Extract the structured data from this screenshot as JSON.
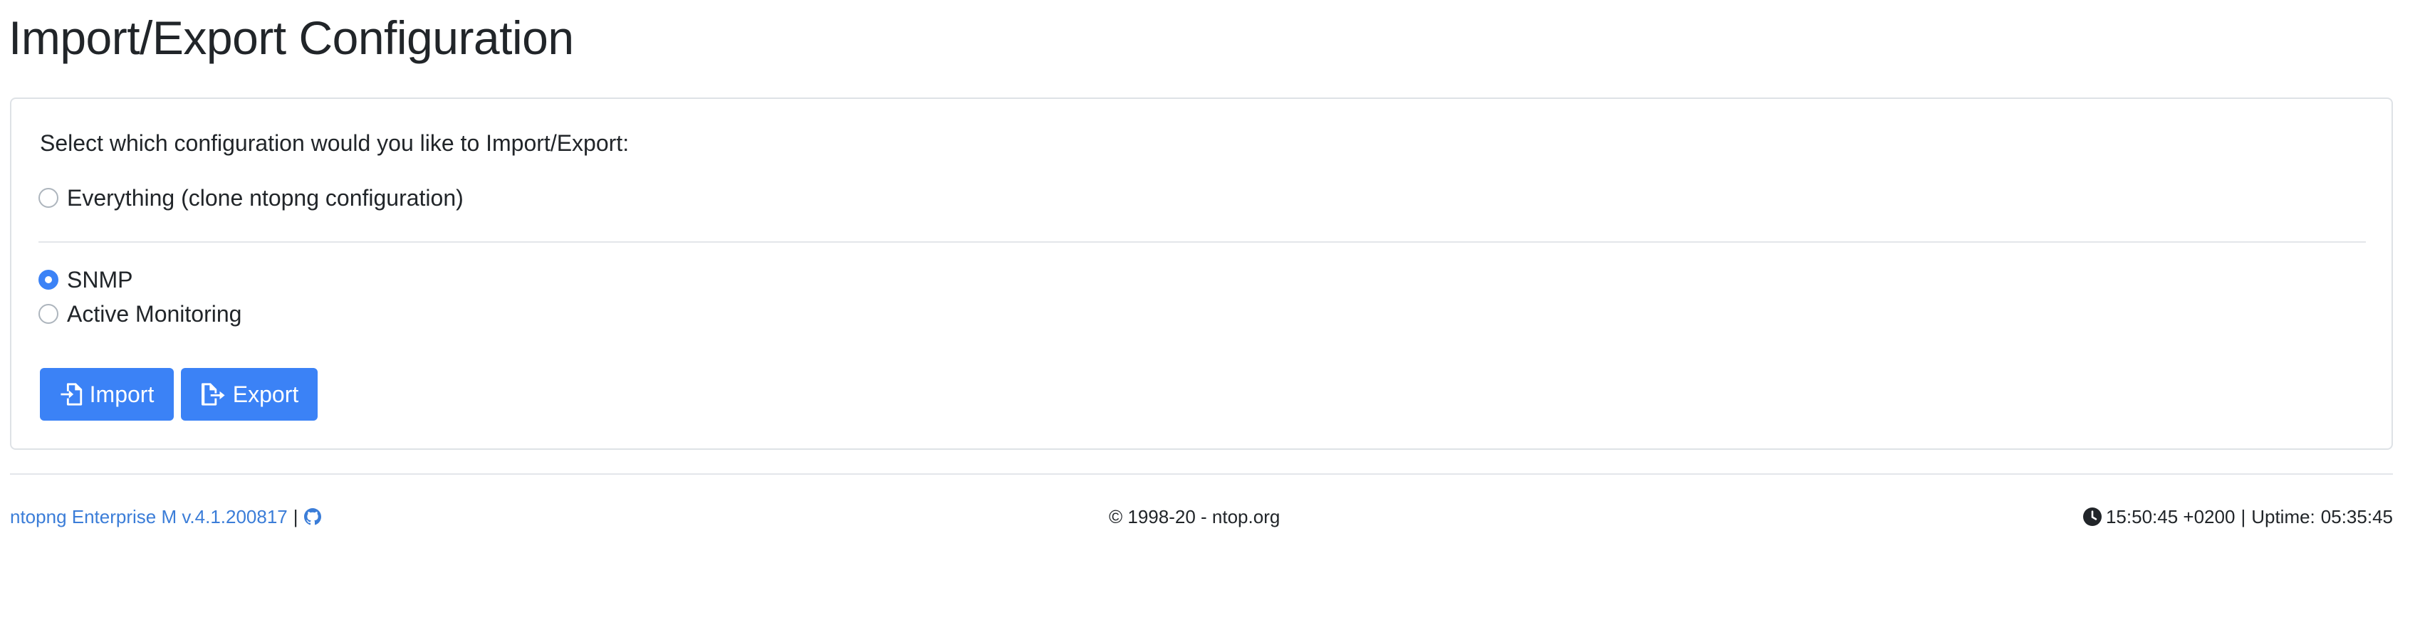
{
  "page": {
    "title": "Import/Export Configuration"
  },
  "config": {
    "prompt": "Select which configuration would you like to Import/Export:",
    "options": [
      {
        "label": "Everything (clone ntopng configuration)",
        "checked": false
      },
      {
        "label": "SNMP",
        "checked": true
      },
      {
        "label": "Active Monitoring",
        "checked": false
      }
    ],
    "import_label": "Import",
    "export_label": "Export"
  },
  "footer": {
    "version_link": "ntopng Enterprise M v.4.1.200817",
    "separator": "|",
    "copyright": "© 1998-20 - ntop.org",
    "time": "15:50:45 +0200",
    "uptime_separator": "|",
    "uptime_label": "Uptime:",
    "uptime_value": "05:35:45"
  },
  "icons": {
    "github": "github-icon",
    "clock": "clock-icon",
    "import": "file-import-icon",
    "export": "file-export-icon"
  },
  "colors": {
    "accent": "#3b82f6",
    "link": "#3b7dd8",
    "border": "#dee2e6"
  }
}
